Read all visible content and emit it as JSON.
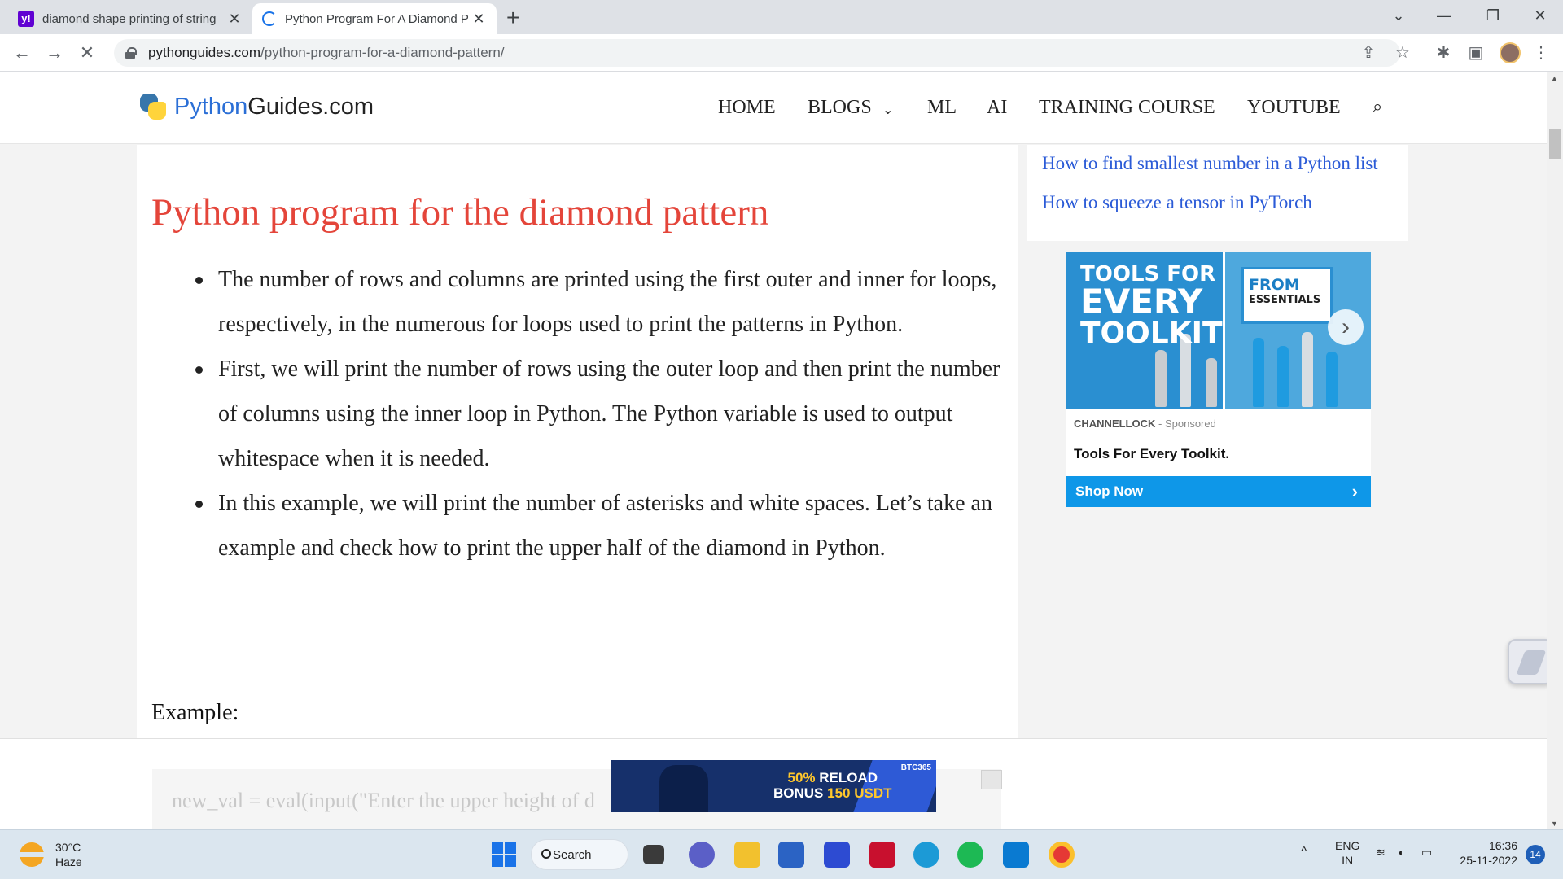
{
  "browser": {
    "tabs": [
      {
        "title": "diamond shape printing of string",
        "favicon": "yahoo-icon"
      },
      {
        "title": "Python Program For A Diamond P",
        "favicon": "loading-spinner-icon"
      }
    ],
    "url_host": "pythonguides.com",
    "url_path": "/python-program-for-a-diamond-pattern/"
  },
  "site": {
    "logo_part1": "Python",
    "logo_part2": "Guides.com",
    "nav": [
      "HOME",
      "BLOGS",
      "ML",
      "AI",
      "TRAINING COURSE",
      "YOUTUBE"
    ]
  },
  "article": {
    "heading": "Python program for the diamond pattern",
    "bullets": [
      "The number of rows and columns are printed using the first outer and inner for loops, respectively, in the numerous for loops used to print the patterns in Python.",
      "First, we will print the number of rows using the outer loop and then print the number of columns using the inner loop in Python. The Python variable is used to output whitespace when it is needed.",
      "In this example, we will print the number of asterisks and white spaces. Let’s take an example and check how to print the upper half of the diamond in Python."
    ],
    "example_label": "Example:",
    "code_line": "new_val = eval(input(\"Enter the upper height of d"
  },
  "sidebar": {
    "links": [
      "How to find smallest number in a Python list",
      "How to squeeze a tensor in PyTorch"
    ]
  },
  "ad": {
    "image_text_1": "TOOLS FOR",
    "image_text_2": "EVERY",
    "image_text_3": "TOOLKIT",
    "tag_1": "FROM",
    "tag_2": "ESSENTIALS",
    "brand": "CHANNELLOCK",
    "sponsored": "- Sponsored",
    "title": "Tools For Every Toolkit.",
    "cta": "Shop Now"
  },
  "banner_ad": {
    "brand": "BTC365",
    "pct": "50%",
    "line1": "RELOAD",
    "line2": "BONUS",
    "amount": "150 USDT"
  },
  "taskbar": {
    "temperature": "30°C",
    "weather": "Haze",
    "search_label": "Search",
    "lang1": "ENG",
    "lang2": "IN",
    "time": "16:36",
    "date": "25-11-2022",
    "notifications": "14"
  }
}
